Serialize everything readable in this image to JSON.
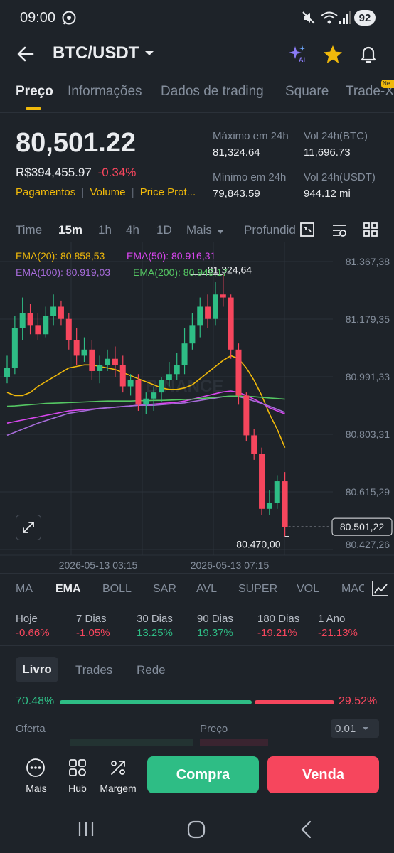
{
  "status_bar": {
    "time": "09:00",
    "battery": "92"
  },
  "header": {
    "pair": "BTC/USDT",
    "ai_badge": "AI"
  },
  "tabs": [
    {
      "label": "Preço",
      "active": true
    },
    {
      "label": "Informações"
    },
    {
      "label": "Dados de trading"
    },
    {
      "label": "Square"
    },
    {
      "label": "Trade-X"
    }
  ],
  "new_badge": "Ne",
  "price": {
    "last": "80,501.22",
    "fiat": "R$394,455.97",
    "change": "-0.34%",
    "tags": [
      "Pagamentos",
      "Volume",
      "Price Prot..."
    ]
  },
  "stats": {
    "high_label": "Máximo em 24h",
    "high": "81,324.64",
    "vol_btc_label": "Vol 24h(BTC)",
    "vol_btc": "11,696.73",
    "low_label": "Mínimo em 24h",
    "low": "79,843.59",
    "vol_usdt_label": "Vol 24h(USDT)",
    "vol_usdt": "944.12 mi"
  },
  "timeframes": [
    "Time",
    "15m",
    "1h",
    "4h",
    "1D",
    "Mais",
    "Profundid"
  ],
  "active_timeframe": "15m",
  "ema_legend": {
    "ema20": "EMA(20): 80.858,53",
    "ema50": "EMA(50): 80.916,31",
    "ema100": "EMA(100): 80.919,03",
    "ema200": "EMA(200): 80.949,17"
  },
  "colors": {
    "up": "#2ebd85",
    "down": "#f6465d",
    "accent": "#f0b90b",
    "ema20": "#f0b90b",
    "ema50": "#d946ef",
    "ema100": "#a66bd9",
    "ema200": "#55c763"
  },
  "chart_data": {
    "type": "candlestick",
    "y_ticks": [
      "81.367,38",
      "81.179,35",
      "80.991,33",
      "80.803,31",
      "80.615,29",
      "80.427,26"
    ],
    "x_ticks": [
      "2026-05-13 03:15",
      "2026-05-13 07:15"
    ],
    "ylim": [
      80427.26,
      81367.38
    ],
    "high_label": "81.324,64",
    "low_label": "80.470,00",
    "last_price_label": "80.501,22",
    "watermark": "BINANCE",
    "candles": [
      {
        "o": 80990,
        "h": 81060,
        "l": 80970,
        "c": 81020
      },
      {
        "o": 81020,
        "h": 81190,
        "l": 81000,
        "c": 81150
      },
      {
        "o": 81150,
        "h": 81250,
        "l": 81110,
        "c": 81200
      },
      {
        "o": 81200,
        "h": 81230,
        "l": 81130,
        "c": 81160
      },
      {
        "o": 81160,
        "h": 81200,
        "l": 81110,
        "c": 81130
      },
      {
        "o": 81130,
        "h": 81220,
        "l": 81120,
        "c": 81190
      },
      {
        "o": 81190,
        "h": 81260,
        "l": 81160,
        "c": 81220
      },
      {
        "o": 81220,
        "h": 81240,
        "l": 81160,
        "c": 81180
      },
      {
        "o": 81180,
        "h": 81200,
        "l": 81080,
        "c": 81110
      },
      {
        "o": 81110,
        "h": 81150,
        "l": 81030,
        "c": 81060
      },
      {
        "o": 81060,
        "h": 81120,
        "l": 81040,
        "c": 81080
      },
      {
        "o": 81080,
        "h": 81110,
        "l": 80980,
        "c": 81010
      },
      {
        "o": 81010,
        "h": 81060,
        "l": 80970,
        "c": 81030
      },
      {
        "o": 81030,
        "h": 81080,
        "l": 81010,
        "c": 81050
      },
      {
        "o": 81050,
        "h": 81090,
        "l": 80990,
        "c": 81030
      },
      {
        "o": 81030,
        "h": 81060,
        "l": 80940,
        "c": 80960
      },
      {
        "o": 80960,
        "h": 81000,
        "l": 80930,
        "c": 80980
      },
      {
        "o": 80980,
        "h": 81000,
        "l": 80880,
        "c": 80900
      },
      {
        "o": 80900,
        "h": 80940,
        "l": 80870,
        "c": 80920
      },
      {
        "o": 80920,
        "h": 80960,
        "l": 80880,
        "c": 80940
      },
      {
        "o": 80940,
        "h": 80990,
        "l": 80910,
        "c": 80980
      },
      {
        "o": 80980,
        "h": 81040,
        "l": 80960,
        "c": 81000
      },
      {
        "o": 81000,
        "h": 81070,
        "l": 80980,
        "c": 81030
      },
      {
        "o": 81030,
        "h": 81150,
        "l": 81000,
        "c": 81100
      },
      {
        "o": 81100,
        "h": 81200,
        "l": 81080,
        "c": 81160
      },
      {
        "o": 81160,
        "h": 81250,
        "l": 81120,
        "c": 81220
      },
      {
        "o": 81220,
        "h": 81260,
        "l": 81150,
        "c": 81180
      },
      {
        "o": 81180,
        "h": 81300,
        "l": 81160,
        "c": 81260
      },
      {
        "o": 81260,
        "h": 81324.64,
        "l": 81220,
        "c": 81250
      },
      {
        "o": 81250,
        "h": 81260,
        "l": 81050,
        "c": 81080
      },
      {
        "o": 81080,
        "h": 81100,
        "l": 80900,
        "c": 80930
      },
      {
        "o": 80930,
        "h": 80940,
        "l": 80780,
        "c": 80800
      },
      {
        "o": 80800,
        "h": 80820,
        "l": 80720,
        "c": 80740
      },
      {
        "o": 80740,
        "h": 80760,
        "l": 80540,
        "c": 80560
      },
      {
        "o": 80560,
        "h": 80620,
        "l": 80540,
        "c": 80580
      },
      {
        "o": 80580,
        "h": 80670,
        "l": 80560,
        "c": 80650
      },
      {
        "o": 80650,
        "h": 80680,
        "l": 80470,
        "c": 80501.22
      }
    ],
    "ema_series": [
      {
        "name": "EMA(20)",
        "values": [
          80940,
          80930,
          80930,
          80940,
          80960,
          80975,
          80990,
          81005,
          81020,
          81025,
          81030,
          81030,
          81025,
          81020,
          81015,
          81005,
          80995,
          80985,
          80975,
          80965,
          80955,
          80950,
          80950,
          80955,
          80965,
          80985,
          81005,
          81025,
          81045,
          81060,
          81050,
          81020,
          80980,
          80930,
          80870,
          80820,
          80760
        ]
      },
      {
        "name": "EMA(50)",
        "values": [
          80840,
          80845,
          80850,
          80855,
          80860,
          80865,
          80870,
          80875,
          80880,
          80882,
          80884,
          80886,
          80888,
          80890,
          80892,
          80894,
          80896,
          80898,
          80900,
          80902,
          80904,
          80906,
          80908,
          80912,
          80918,
          80924,
          80930,
          80936,
          80942,
          80945,
          80940,
          80930,
          80918,
          80905,
          80890,
          80880,
          80870
        ]
      },
      {
        "name": "EMA(100)",
        "values": [
          80800,
          80810,
          80820,
          80830,
          80840,
          80848,
          80856,
          80864,
          80872,
          80876,
          80880,
          80884,
          80888,
          80890,
          80892,
          80894,
          80896,
          80898,
          80898,
          80898,
          80900,
          80902,
          80904,
          80906,
          80910,
          80914,
          80918,
          80922,
          80926,
          80928,
          80926,
          80920,
          80912,
          80904,
          80895,
          80885,
          80875
        ]
      },
      {
        "name": "EMA(200)",
        "values": [
          80895,
          80896,
          80898,
          80900,
          80902,
          80904,
          80905,
          80906,
          80907,
          80908,
          80909,
          80910,
          80911,
          80912,
          80912,
          80912,
          80912,
          80913,
          80913,
          80914,
          80914,
          80915,
          80916,
          80917,
          80918,
          80920,
          80922,
          80924,
          80926,
          80928,
          80928,
          80927,
          80926,
          80924,
          80922,
          80920,
          80918
        ]
      }
    ]
  },
  "indicators": [
    "MA",
    "EMA",
    "BOLL",
    "SAR",
    "AVL",
    "SUPER",
    "VOL",
    "MAC"
  ],
  "active_indicator": "EMA",
  "performance": [
    {
      "label": "Hoje",
      "value": "-0.66%",
      "dir": "down"
    },
    {
      "label": "7 Dias",
      "value": "-1.05%",
      "dir": "down"
    },
    {
      "label": "30 Dias",
      "value": "13.25%",
      "dir": "up"
    },
    {
      "label": "90 Dias",
      "value": "19.37%",
      "dir": "up"
    },
    {
      "label": "180 Dias",
      "value": "-19.21%",
      "dir": "down"
    },
    {
      "label": "1 Ano",
      "value": "-21.13%",
      "dir": "down"
    }
  ],
  "book_tabs": [
    "Livro",
    "Trades",
    "Rede"
  ],
  "book": {
    "buy_pct": "70.48%",
    "buy_ratio": 0.7048,
    "sell_pct": "29.52%",
    "bid_label": "Oferta",
    "price_label": "Preço",
    "precision": "0.01"
  },
  "bottom": {
    "more": "Mais",
    "hub": "Hub",
    "margin": "Margem",
    "buy": "Compra",
    "sell": "Venda"
  }
}
